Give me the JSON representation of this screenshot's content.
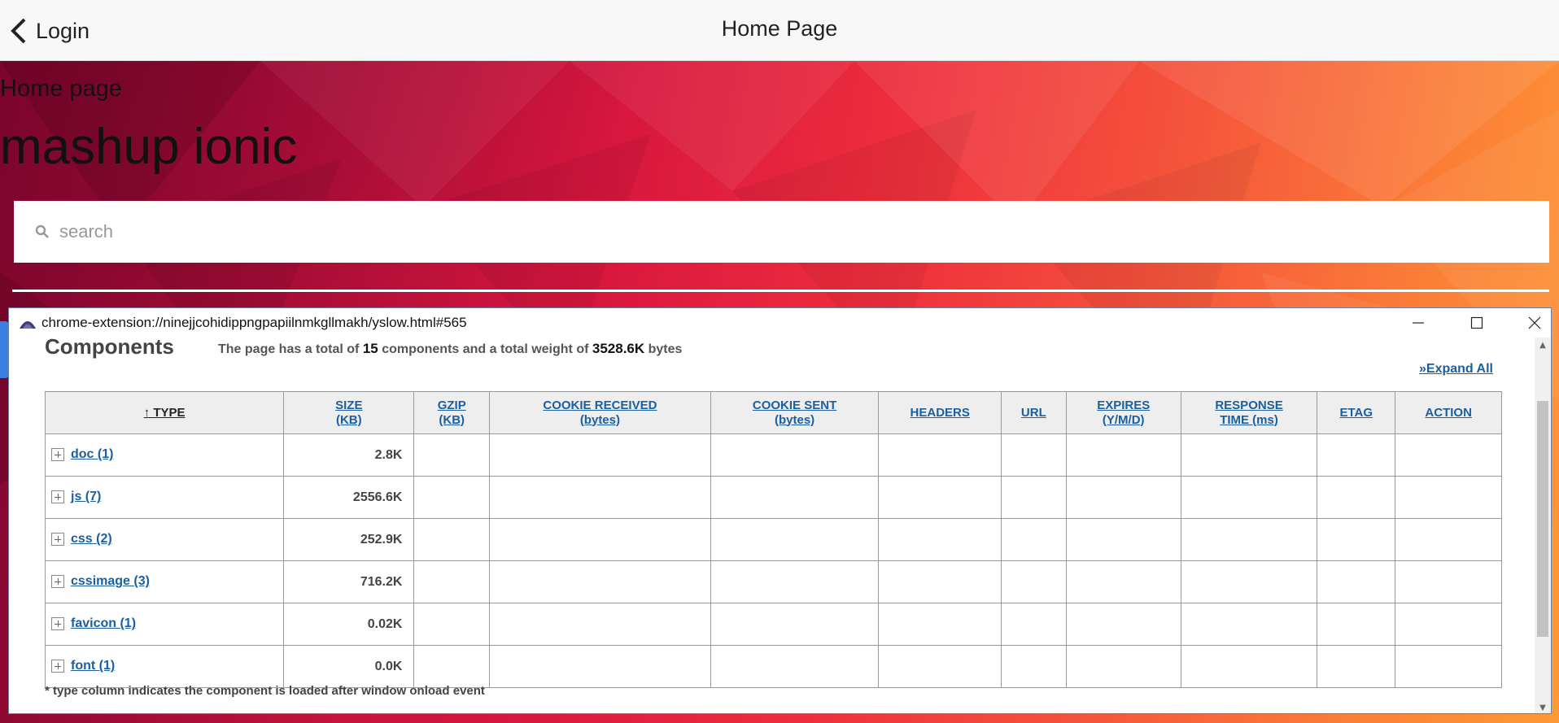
{
  "header": {
    "back_label": "Login",
    "title": "Home Page"
  },
  "hero": {
    "subtitle": "Home page",
    "title": "mashup ionic",
    "search_placeholder": "search"
  },
  "popup": {
    "url": "chrome-extension://ninejjcohidippngpapiilnmkgllmakh/yslow.html#565",
    "heading": "Components",
    "summary": {
      "prefix": "The page has a total of",
      "components": "15",
      "middle": "components and a total weight of",
      "weight": "3528.6K",
      "suffix": "bytes"
    },
    "expand_all": "»Expand All",
    "columns": [
      {
        "line1": "↑ TYPE",
        "line2": ""
      },
      {
        "line1": "SIZE",
        "line2": "(KB)"
      },
      {
        "line1": "GZIP",
        "line2": "(KB)"
      },
      {
        "line1": "COOKIE RECEIVED",
        "line2": "(bytes)"
      },
      {
        "line1": "COOKIE SENT",
        "line2": "(bytes)"
      },
      {
        "line1": "HEADERS",
        "line2": ""
      },
      {
        "line1": "URL",
        "line2": ""
      },
      {
        "line1": "EXPIRES",
        "line2": "(Y/M/D)"
      },
      {
        "line1": "RESPONSE",
        "line2": "TIME (ms)"
      },
      {
        "line1": "ETAG",
        "line2": ""
      },
      {
        "line1": "ACTION",
        "line2": ""
      }
    ],
    "rows": [
      {
        "type": "doc (1)",
        "size": "2.8K"
      },
      {
        "type": "js (7)",
        "size": "2556.6K"
      },
      {
        "type": "css (2)",
        "size": "252.9K"
      },
      {
        "type": "cssimage (3)",
        "size": "716.2K"
      },
      {
        "type": "favicon (1)",
        "size": "0.02K"
      },
      {
        "type": "font (1)",
        "size": "0.0K"
      }
    ],
    "footnote": "* type column indicates the component is loaded after window onload event"
  },
  "colors": {
    "link": "#1a5fa0",
    "hero_start": "#8a0a32",
    "hero_end": "#fd9a35"
  },
  "icons": [
    "chevron-left-icon",
    "search-icon",
    "favicon-icon",
    "minimize-icon",
    "maximize-icon",
    "close-icon",
    "expand-icon"
  ]
}
